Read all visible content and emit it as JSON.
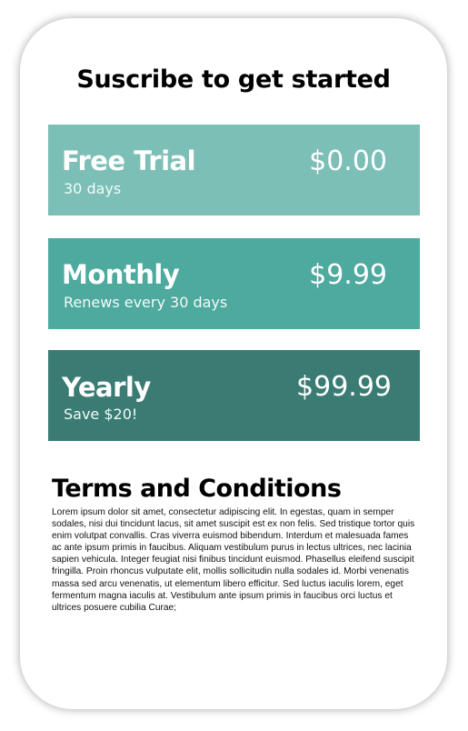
{
  "page": {
    "title": "Suscribe to get started"
  },
  "plans": [
    {
      "name": "Free Trial",
      "subtitle": "30 days",
      "price": "$0.00",
      "color": "#7cbfb6"
    },
    {
      "name": "Monthly",
      "subtitle": "Renews every 30 days",
      "price": "$9.99",
      "color": "#4ea99e"
    },
    {
      "name": "Yearly",
      "subtitle": "Save $20!",
      "price": "$99.99",
      "color": "#3a7c73"
    }
  ],
  "terms": {
    "title": "Terms and Conditions",
    "body": "Lorem ipsum dolor sit amet, consectetur adipiscing elit. In egestas, quam in semper sodales, nisi dui tincidunt lacus, sit amet suscipit est ex non felis. Sed tristique tortor quis enim volutpat convallis. Cras viverra euismod bibendum. Interdum et malesuada fames ac ante ipsum primis in faucibus. Aliquam vestibulum purus in lectus ultrices, nec lacinia sapien vehicula. Integer feugiat nisi finibus tincidunt euismod. Phasellus eleifend suscipit fringilla. Proin rhoncus vulputate elit, mollis sollicitudin nulla sodales id. Morbi venenatis massa sed arcu venenatis, ut elementum libero efficitur. Sed luctus iaculis lorem, eget fermentum magna iaculis at. Vestibulum ante ipsum primis in faucibus orci luctus et ultrices posuere cubilia Curae;"
  }
}
